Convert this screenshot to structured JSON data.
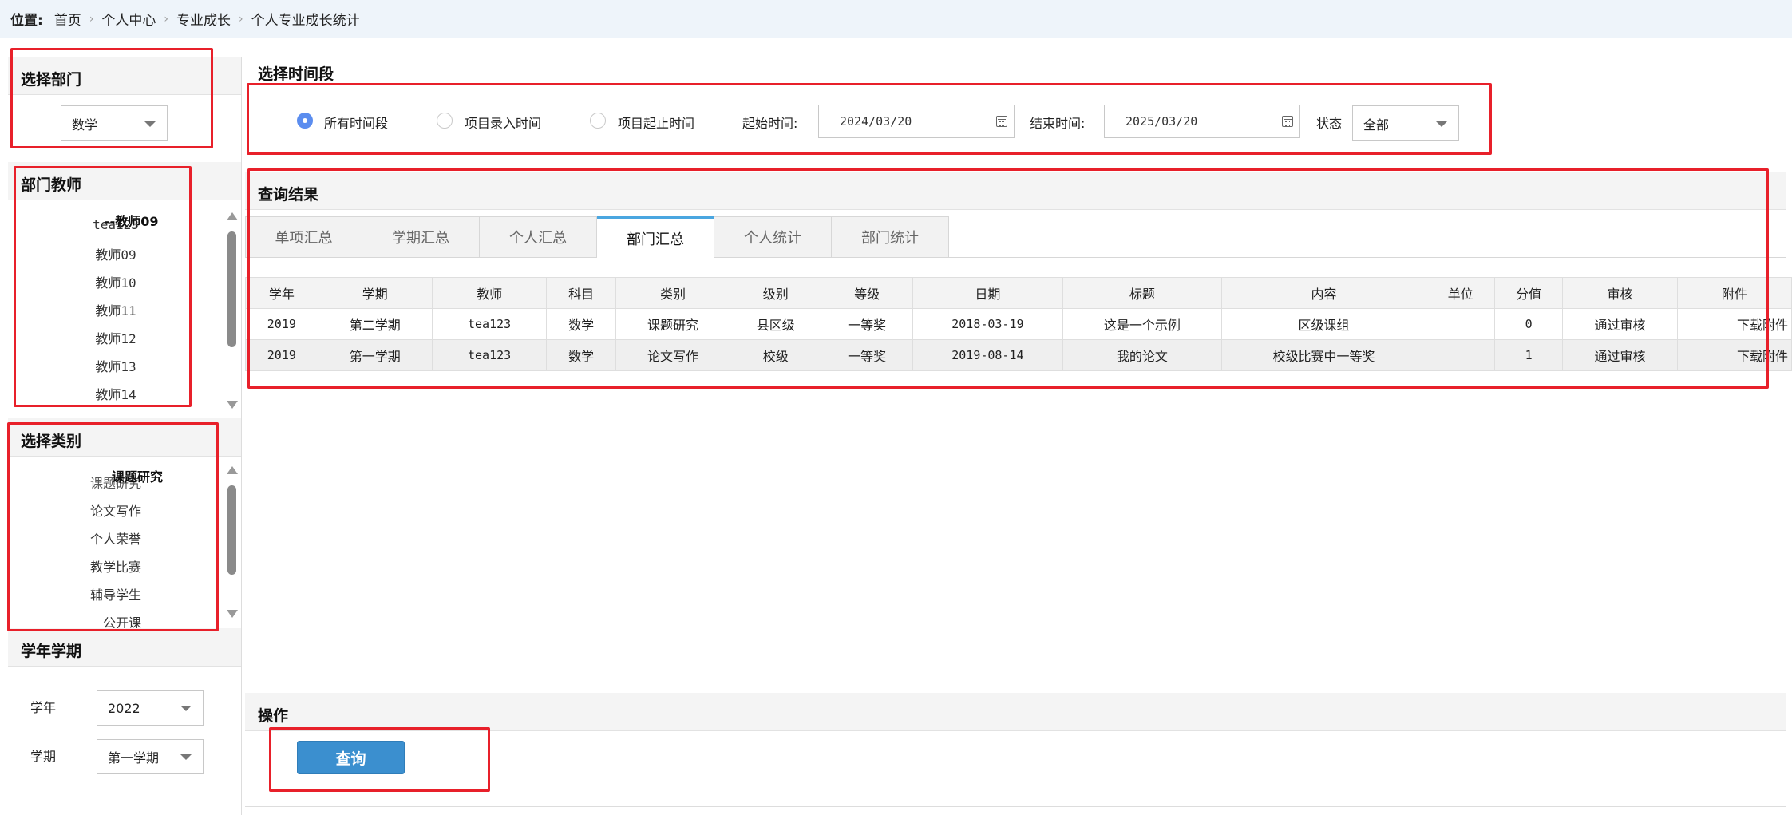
{
  "breadcrumb": {
    "label": "位置:",
    "items": [
      "首页",
      "个人中心",
      "专业成长",
      "个人专业成长统计"
    ],
    "separator": "›"
  },
  "dept_panel": {
    "title": "选择部门",
    "selected": "数学"
  },
  "teacher_panel": {
    "title": "部门教师",
    "overlay_label": "--教师09",
    "items": [
      "tea123",
      "教师09",
      "教师10",
      "教师11",
      "教师12",
      "教师13",
      "教师14"
    ]
  },
  "category_panel": {
    "title": "选择类别",
    "overlay_label": "课题研究",
    "items": [
      "课题研究",
      "论文写作",
      "个人荣誉",
      "教学比赛",
      "辅导学生",
      "公开课"
    ]
  },
  "term_panel": {
    "title": "学年学期",
    "year_label": "学年",
    "year_value": "2022",
    "term_label": "学期",
    "term_value": "第一学期"
  },
  "time_panel": {
    "title": "选择时间段",
    "radio_all": "所有时间段",
    "radio_entry": "项目录入时间",
    "radio_range": "项目起止时间",
    "start_label": "起始时间:",
    "start_value": "2024/03/20",
    "end_label": "结束时间:",
    "end_value": "2025/03/20",
    "status_label": "状态",
    "status_value": "全部"
  },
  "results": {
    "title": "查询结果",
    "tabs": [
      "单项汇总",
      "学期汇总",
      "个人汇总",
      "部门汇总",
      "个人统计",
      "部门统计"
    ],
    "active_tab": "部门汇总",
    "columns": [
      "学年",
      "学期",
      "教师",
      "科目",
      "类别",
      "级别",
      "等级",
      "日期",
      "标题",
      "内容",
      "单位",
      "分值",
      "审核",
      "附件"
    ],
    "rows": [
      [
        "2019",
        "第二学期",
        "tea123",
        "数学",
        "课题研究",
        "县区级",
        "一等奖",
        "2018-03-19",
        "这是一个示例",
        "区级课组",
        "",
        "0",
        "通过审核",
        "下载附件"
      ],
      [
        "2019",
        "第一学期",
        "tea123",
        "数学",
        "论文写作",
        "校级",
        "一等奖",
        "2019-08-14",
        "我的论文",
        "校级比赛中一等奖",
        "",
        "1",
        "通过审核",
        "下载附件"
      ]
    ]
  },
  "operation": {
    "title": "操作",
    "query_button": "查询"
  },
  "colors": {
    "highlight": "#e8202a",
    "accent": "#3b8fcf",
    "tab_accent": "#4aa6e0"
  }
}
